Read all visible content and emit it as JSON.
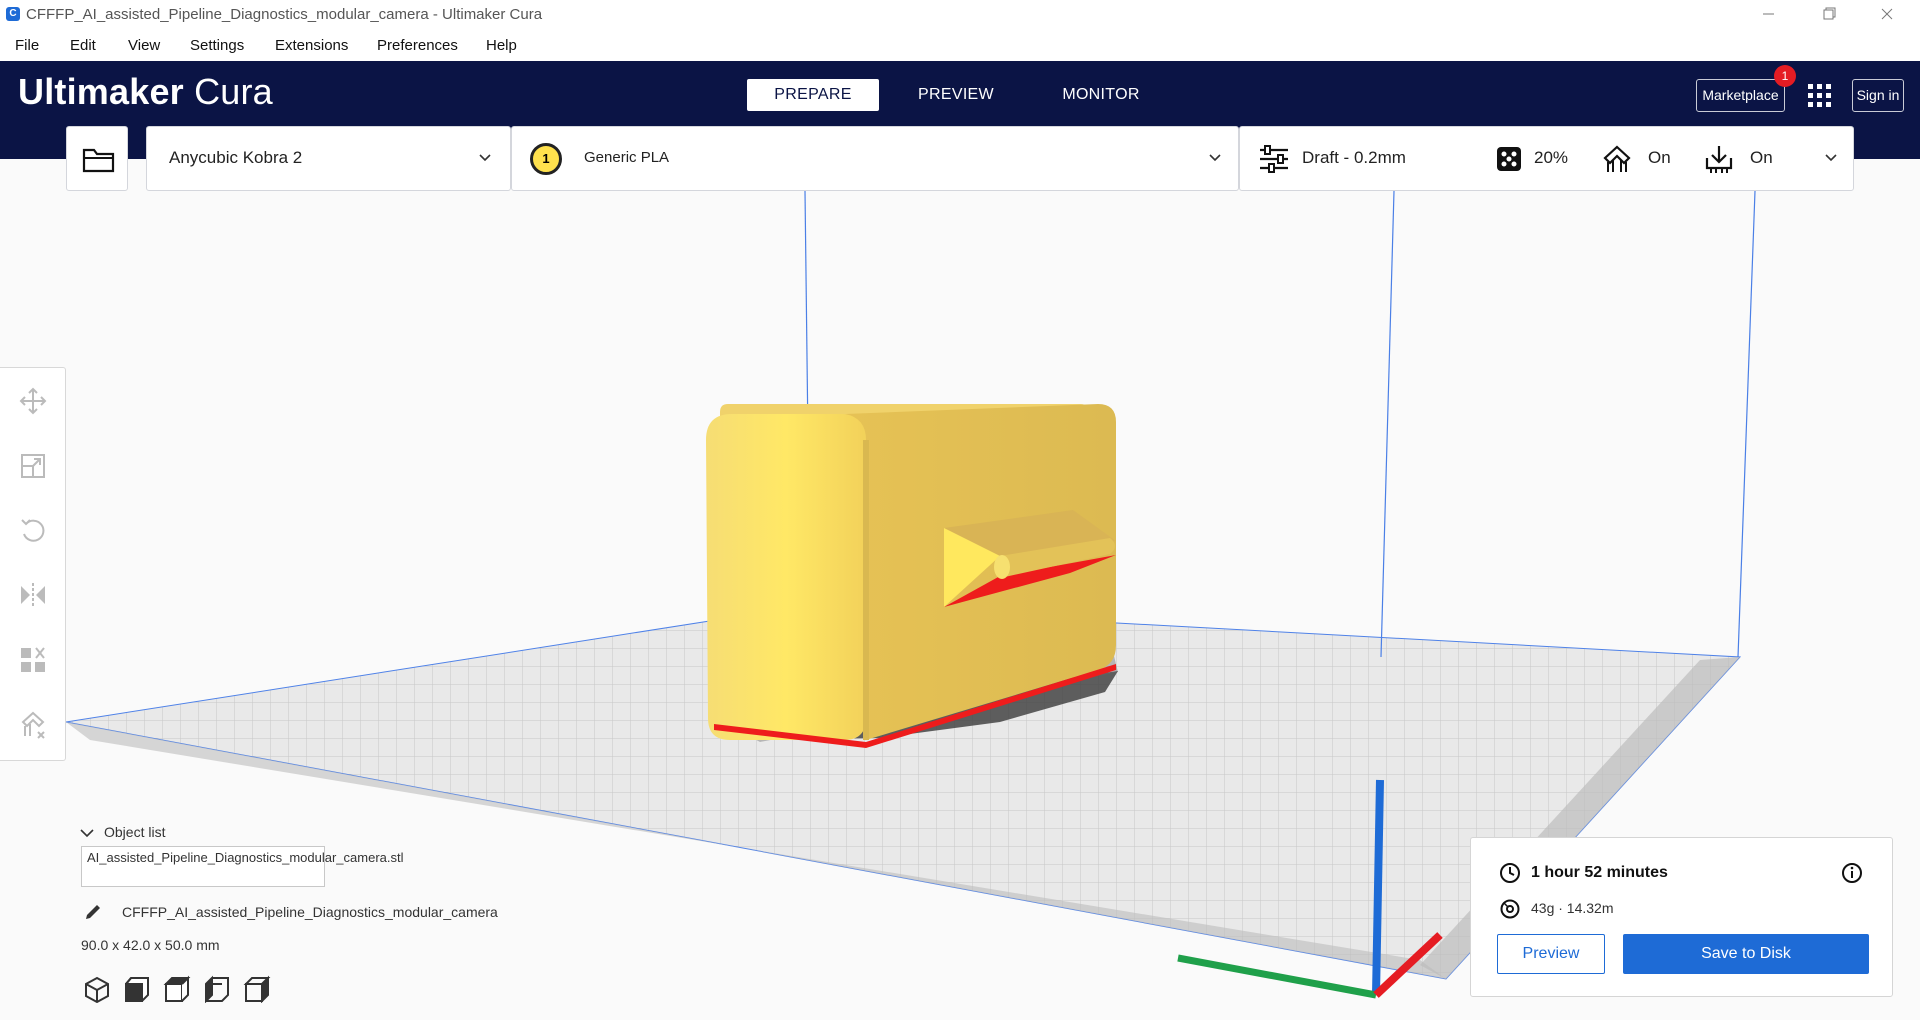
{
  "window": {
    "title": "CFFFP_AI_assisted_Pipeline_Diagnostics_modular_camera - Ultimaker Cura",
    "app_icon": "C",
    "controls": [
      "minimize-icon",
      "restore-icon",
      "close-icon"
    ]
  },
  "menu": {
    "items": [
      "File",
      "Edit",
      "View",
      "Settings",
      "Extensions",
      "Preferences",
      "Help"
    ]
  },
  "header": {
    "logo_bold": "Ultimaker",
    "logo_light": "Cura",
    "stages": [
      "PREPARE",
      "PREVIEW",
      "MONITOR"
    ],
    "active_stage": "PREPARE",
    "marketplace_label": "Marketplace",
    "marketplace_badge": "1",
    "sign_in_label": "Sign in",
    "apps_icon": "grid-icon"
  },
  "toolbar": {
    "open_icon": "folder-icon",
    "printer": "Anycubic Kobra 2",
    "extruder_number": "1",
    "material": "Generic PLA",
    "profile": "Draft - 0.2mm",
    "infill": "20%",
    "support": "On",
    "adhesion": "On"
  },
  "tools": [
    "move-icon",
    "scale-icon",
    "rotate-icon",
    "mirror-icon",
    "per-model-settings-icon",
    "support-blocker-icon"
  ],
  "object_list": {
    "toggle_label": "Object list",
    "file_name": "AI_assisted_Pipeline_Diagnostics_modular_camera.stl",
    "job_name": "CFFFP_AI_assisted_Pipeline_Diagnostics_modular_camera",
    "dimensions": "90.0 x 42.0 x 50.0 mm",
    "view_buttons": [
      "view-3d-icon",
      "view-front-icon",
      "view-top-icon",
      "view-left-icon",
      "view-right-icon"
    ]
  },
  "print_panel": {
    "time": "1 hour 52 minutes",
    "material_usage": "43g · 14.32m",
    "preview_label": "Preview",
    "save_label": "Save to Disk"
  },
  "colors": {
    "header_bg": "#0b1445",
    "accent_blue": "#1e6bd6",
    "model_yellow": "#f4d76a",
    "overhang_red": "#ee1c1c"
  }
}
